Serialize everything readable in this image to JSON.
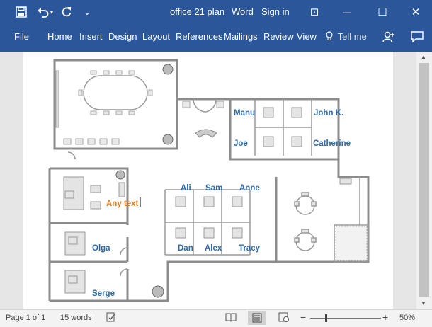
{
  "window": {
    "title": "office 21 plan",
    "app_name": "Word",
    "sign_in": "Sign in",
    "controls": {
      "ribbon_display": "⊡",
      "minimize": "—",
      "maximize": "☐",
      "close": "✕"
    }
  },
  "quick_access": {
    "save_icon": "save-icon",
    "undo_icon": "undo-icon",
    "redo_icon": "redo-icon",
    "customize": "⌄"
  },
  "ribbon": {
    "tabs": [
      "File",
      "Home",
      "Insert",
      "Design",
      "Layout",
      "References",
      "Mailings",
      "Review",
      "View"
    ],
    "tell_me": "Tell me",
    "share_icon": "share-person-icon",
    "comments_icon": "comment-icon"
  },
  "floor_plan": {
    "labels": [
      "Manu",
      "John K.",
      "Joe",
      "Catherine",
      "Ali",
      "Sam",
      "Anne",
      "Dan",
      "Alex",
      "Tracy",
      "Olga",
      "Serge"
    ],
    "selected_text": "Any text"
  },
  "status_bar": {
    "page": "Page 1 of 1",
    "words": "15 words",
    "zoom": "50%",
    "zoom_out": "−",
    "zoom_in": "+",
    "zoom_level": 0.5
  },
  "colors": {
    "ribbon": "#2b579a",
    "label_blue": "#2e6aa8",
    "label_orange": "#e2791d",
    "wall": "#808080"
  }
}
